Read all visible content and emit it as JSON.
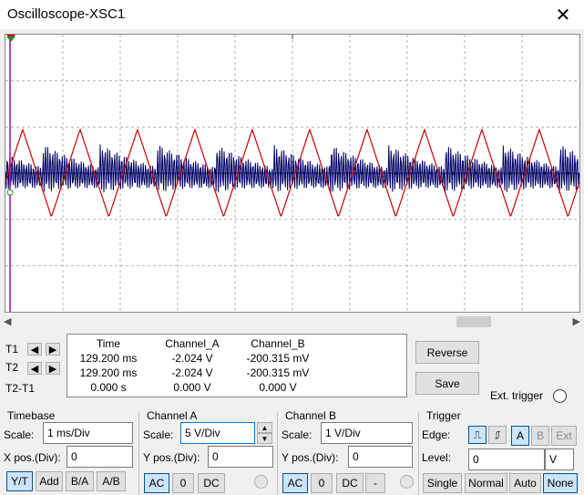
{
  "window": {
    "title": "Oscilloscope-XSC1",
    "close_glyph": "✕"
  },
  "scope": {
    "background": "#ffffff",
    "grid_color": "#b4b4b4",
    "channel_a_color": "#cc0000",
    "channel_b_color": "#000066",
    "cursor_color": "#b000b0"
  },
  "chart_data": {
    "type": "line",
    "series": [
      {
        "name": "Channel_A",
        "color": "#cc0000",
        "shape": "triangle wave",
        "cycles": 10
      },
      {
        "name": "Channel_B",
        "color": "#000066",
        "shape": "high-frequency oscillation bursts",
        "cycles": 10
      }
    ],
    "grid": true
  },
  "cursors": {
    "t1_label": "T1",
    "t2_label": "T2",
    "diff_label": "T2-T1",
    "left_arrow": "◀",
    "right_arrow": "▶"
  },
  "readout": {
    "headers": {
      "time": "Time",
      "a": "Channel_A",
      "b": "Channel_B"
    },
    "rows": [
      {
        "time": "129.200 ms",
        "a": "-2.024 V",
        "b": "-200.315 mV"
      },
      {
        "time": "129.200 ms",
        "a": "-2.024 V",
        "b": "-200.315 mV"
      },
      {
        "time": "0.000 s",
        "a": "0.000 V",
        "b": "0.000 V"
      }
    ]
  },
  "actions": {
    "reverse": "Reverse",
    "save": "Save",
    "ext_trigger": "Ext. trigger"
  },
  "timebase": {
    "heading": "Timebase",
    "scale_label": "Scale:",
    "scale_value": "1 ms/Div",
    "xpos_label": "X pos.(Div):",
    "xpos_value": "0",
    "modes": [
      "Y/T",
      "Add",
      "B/A",
      "A/B"
    ]
  },
  "channel_a": {
    "heading": "Channel A",
    "scale_label": "Scale:",
    "scale_value": "5  V/Div",
    "ypos_label": "Y pos.(Div):",
    "ypos_value": "0",
    "coupling": [
      "AC",
      "0",
      "DC"
    ]
  },
  "channel_b": {
    "heading": "Channel B",
    "scale_label": "Scale:",
    "scale_value": "1  V/Div",
    "ypos_label": "Y pos.(Div):",
    "ypos_value": "0",
    "coupling": [
      "AC",
      "0",
      "DC",
      "-"
    ]
  },
  "trigger": {
    "heading": "Trigger",
    "edge_label": "Edge:",
    "edge_rise": "⎍",
    "edge_fall": "⎎",
    "sources": [
      "A",
      "B",
      "Ext"
    ],
    "level_label": "Level:",
    "level_value": "0",
    "level_unit": "V",
    "modes": [
      "Single",
      "Normal",
      "Auto",
      "None"
    ]
  }
}
